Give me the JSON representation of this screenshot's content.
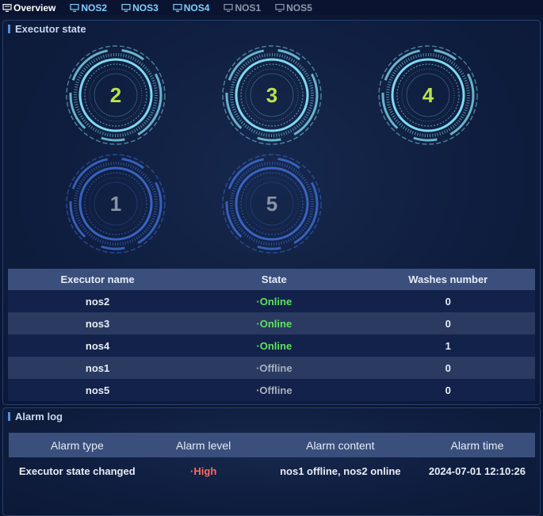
{
  "tabs": [
    {
      "label": "Overview",
      "status": "active",
      "icon": "overview-icon"
    },
    {
      "label": "NOS2",
      "status": "online",
      "icon": "monitor-icon"
    },
    {
      "label": "NOS3",
      "status": "online",
      "icon": "monitor-icon"
    },
    {
      "label": "NOS4",
      "status": "online",
      "icon": "monitor-icon"
    },
    {
      "label": "NOS1",
      "status": "offline",
      "icon": "monitor-icon"
    },
    {
      "label": "NOS5",
      "status": "offline",
      "icon": "monitor-icon"
    }
  ],
  "executor_panel": {
    "title": "Executor state",
    "circles": [
      {
        "number": "2",
        "status": "online"
      },
      {
        "number": "3",
        "status": "online"
      },
      {
        "number": "4",
        "status": "online"
      },
      {
        "number": "1",
        "status": "offline"
      },
      {
        "number": "5",
        "status": "offline"
      }
    ],
    "columns": [
      "Executor name",
      "State",
      "Washes number"
    ],
    "rows": [
      {
        "name": "nos2",
        "state": "·Online",
        "washes": "0",
        "status": "online"
      },
      {
        "name": "nos3",
        "state": "·Online",
        "washes": "0",
        "status": "online"
      },
      {
        "name": "nos4",
        "state": "·Online",
        "washes": "1",
        "status": "online"
      },
      {
        "name": "nos1",
        "state": "·Offline",
        "washes": "0",
        "status": "offline"
      },
      {
        "name": "nos5",
        "state": "·Offline",
        "washes": "0",
        "status": "offline"
      }
    ]
  },
  "alarm_panel": {
    "title": "Alarm log",
    "columns": [
      "Alarm type",
      "Alarm level",
      "Alarm content",
      "Alarm time"
    ],
    "rows": [
      {
        "type": "Executor state changed",
        "level": "·High",
        "content": "nos1 offline, nos2 online",
        "time": "2024-07-01 12:10:26"
      }
    ]
  },
  "colors": {
    "background": "#0b1733",
    "online_ring": "#7fd8f0",
    "offline_ring": "#3f6fd6",
    "online_number": "#b8e24a",
    "offline_number": "#8a93a6",
    "state_online": "#5fe060",
    "state_offline": "#a8b0bf",
    "level_high": "#ff6a5f",
    "header_bg": "#3a4f7c"
  }
}
